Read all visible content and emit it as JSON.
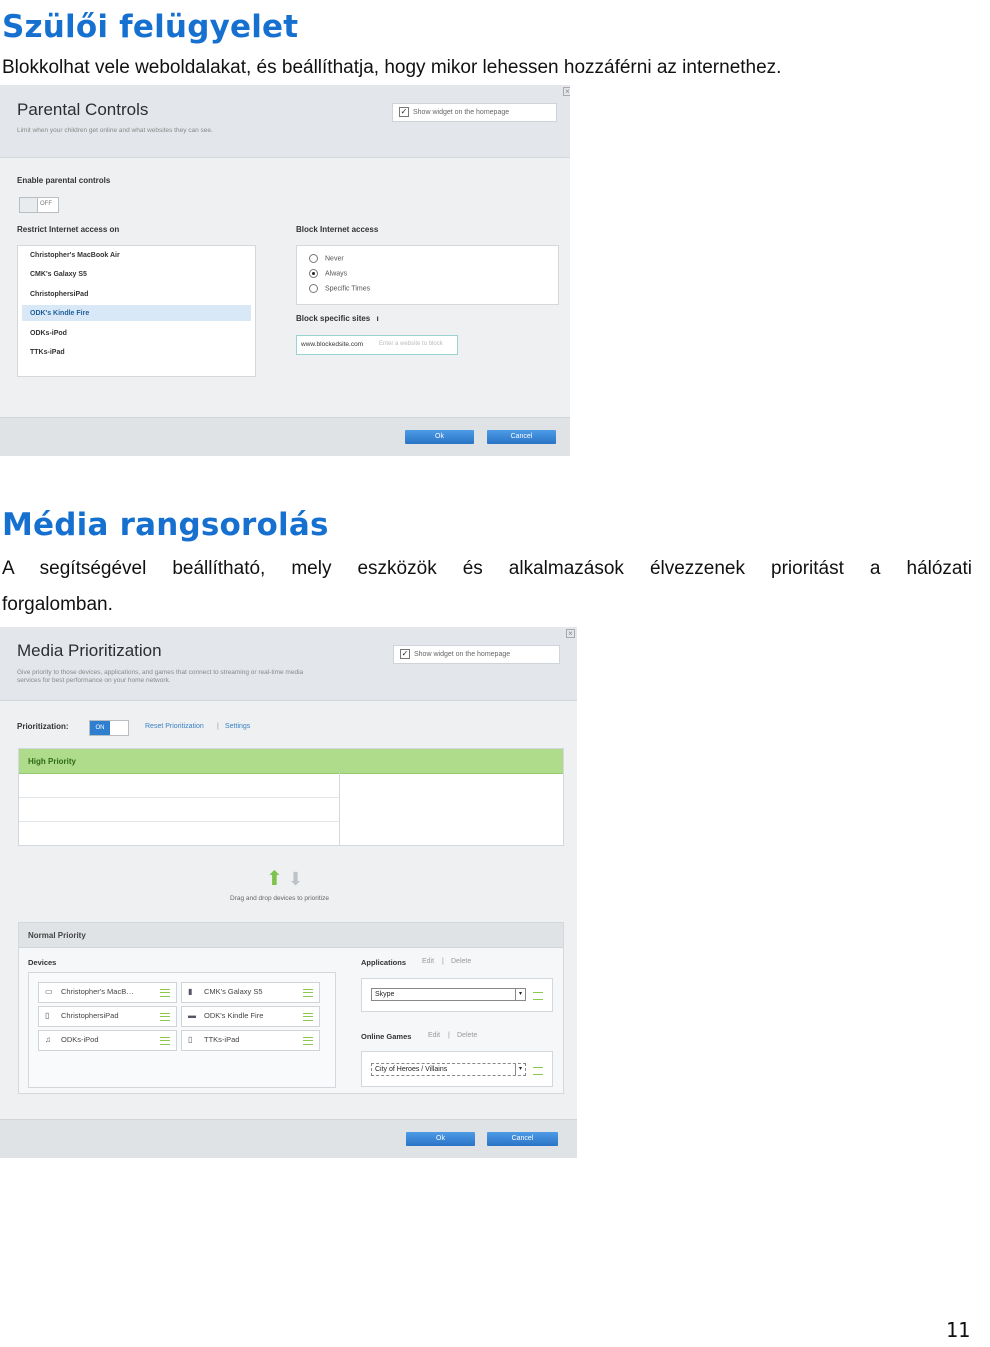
{
  "section1": {
    "title": "Szülői felügyelet",
    "text": "Blokkolhat vele weboldalakat, és beállíthatja, hogy mikor lehessen hozzáférni az internethez."
  },
  "parental": {
    "title": "Parental Controls",
    "subtitle": "Limit when your children get online and what websites they can see.",
    "widget_label": "Show widget on the homepage",
    "enable_label": "Enable parental controls",
    "toggle_state": "OFF",
    "restrict_label": "Restrict Internet access on",
    "devices": [
      "Christopher's MacBook Air",
      "CMK's Galaxy S5",
      "ChristophersiPad",
      "ODK's Kindle Fire",
      "ODKs-iPod",
      "TTKs-iPad"
    ],
    "selected_device_index": 3,
    "block_access_label": "Block Internet access",
    "block_options": [
      "Never",
      "Always",
      "Specific Times"
    ],
    "block_selected": "Always",
    "block_sites_label": "Block specific sites",
    "site_value": "www.blockedsite.com",
    "site_placeholder": "Enter a website to block",
    "ok_label": "Ok",
    "cancel_label": "Cancel"
  },
  "section2": {
    "title": "Média rangsorolás",
    "text_line1": "A segítségével beállítható, mely eszközök és alkalmazások élvezzenek prioritást a hálózati",
    "text_line2": "forgalomban."
  },
  "media": {
    "title": "Media Prioritization",
    "subtitle_line1": "Give priority to those devices, applications, and games that connect to streaming or real-time media",
    "subtitle_line2": "services for best performance on your home network.",
    "widget_label": "Show widget on the homepage",
    "prioritization_label": "Prioritization:",
    "toggle_state": "ON",
    "reset_link": "Reset Prioritization",
    "settings_link": "Settings",
    "high_priority_label": "High Priority",
    "drag_hint": "Drag and drop devices to prioritize",
    "normal_priority_label": "Normal Priority",
    "devices_label": "Devices",
    "devices": [
      {
        "name": "Christopher's MacB…",
        "icon": "laptop-icon"
      },
      {
        "name": "CMK's Galaxy S5",
        "icon": "phone-icon"
      },
      {
        "name": "ChristophersiPad",
        "icon": "tablet-icon"
      },
      {
        "name": "ODK's Kindle Fire",
        "icon": "kindle-icon"
      },
      {
        "name": "ODKs-iPod",
        "icon": "ipod-icon"
      },
      {
        "name": "TTKs-iPad",
        "icon": "tablet-icon"
      }
    ],
    "applications_label": "Applications",
    "edit_label": "Edit",
    "delete_label": "Delete",
    "application_selected": "Skype",
    "online_games_label": "Online Games",
    "game_selected": "City of Heroes / Villains",
    "ok_label": "Ok",
    "cancel_label": "Cancel"
  },
  "page_number": "11"
}
